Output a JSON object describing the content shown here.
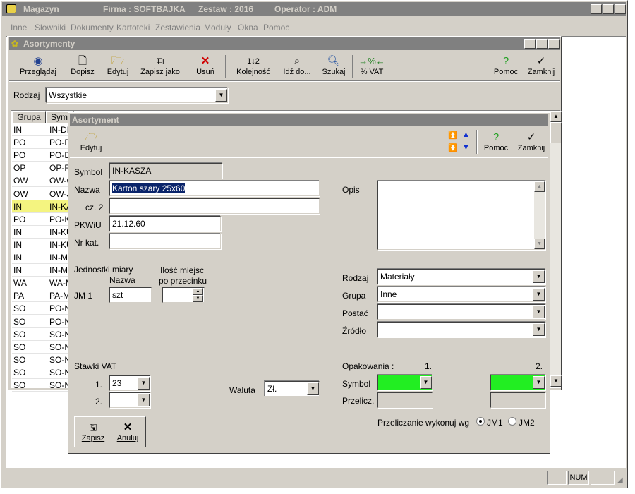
{
  "main_window": {
    "app": "Magazyn",
    "firma": "Firma : SOFTBAJKA",
    "zestaw": "Zestaw : 2016",
    "operator": "Operator : ADM"
  },
  "menu": [
    "Inne",
    "Słowniki",
    "Dokumenty",
    "Kartoteki",
    "Zestawienia",
    "Moduły",
    "Okna",
    "Pomoc"
  ],
  "list_window": {
    "title": "Asortymenty",
    "toolbar": [
      "Przeglądaj",
      "Dopisz",
      "Edytuj",
      "Zapisz jako",
      "Usuń",
      "Kolejność",
      "Idź do...",
      "Szukaj",
      "% VAT",
      "Pomoc",
      "Zamknij"
    ],
    "rodzaj_label": "Rodzaj",
    "rodzaj_value": "Wszystkie",
    "columns": [
      "Grupa",
      "Sym"
    ],
    "rows": [
      {
        "grupa": "IN",
        "sym": "IN-DI"
      },
      {
        "grupa": "PO",
        "sym": "PO-D"
      },
      {
        "grupa": "PO",
        "sym": "PO-D"
      },
      {
        "grupa": "OP",
        "sym": "OP-F"
      },
      {
        "grupa": "OW",
        "sym": "OW-C"
      },
      {
        "grupa": "OW",
        "sym": "OW-J"
      },
      {
        "grupa": "IN",
        "sym": "IN-KA"
      },
      {
        "grupa": "PO",
        "sym": "PO-K"
      },
      {
        "grupa": "IN",
        "sym": "IN-KU"
      },
      {
        "grupa": "IN",
        "sym": "IN-KU"
      },
      {
        "grupa": "IN",
        "sym": "IN-M"
      },
      {
        "grupa": "IN",
        "sym": "IN-MS"
      },
      {
        "grupa": "WA",
        "sym": "WA-M"
      },
      {
        "grupa": "PA",
        "sym": "PA-M"
      },
      {
        "grupa": "SO",
        "sym": "PO-N"
      },
      {
        "grupa": "SO",
        "sym": "PO-N"
      },
      {
        "grupa": "SO",
        "sym": "SO-N"
      },
      {
        "grupa": "SO",
        "sym": "SO-N"
      },
      {
        "grupa": "SO",
        "sym": "SO-N"
      },
      {
        "grupa": "SO",
        "sym": "SO-N"
      },
      {
        "grupa": "SO",
        "sym": "SO-N"
      }
    ]
  },
  "dialog": {
    "title": "Asortyment",
    "edit_label": "Edytuj",
    "pomoc_label": "Pomoc",
    "zamknij_label": "Zamknij",
    "symbol_label": "Symbol",
    "symbol_value": "IN-KASZA",
    "nazwa_label": "Nazwa",
    "nazwa_value": "Karton szary 25x60",
    "cz2_label": "cz. 2",
    "cz2_value": "",
    "pkwiu_label": "PKWiU",
    "pkwiu_value": "21.12.60",
    "nrkat_label": "Nr kat.",
    "nrkat_value": "",
    "opis_label": "Opis",
    "jm_header": "Jednostki miary",
    "jm_nazwa": "Nazwa",
    "ilosc_header1": "Ilość miejsc",
    "ilosc_header2": "po przecinku",
    "jm1_label": "JM 1",
    "jm1_value": "szt",
    "rodzaj_label": "Rodzaj",
    "rodzaj_value": "Materiały",
    "grupa_label": "Grupa",
    "grupa_value": "Inne",
    "postac_label": "Postać",
    "postac_value": "",
    "zrodlo_label": "Źródło",
    "zrodlo_value": "",
    "stawki_label": "Stawki VAT",
    "vat1_label": "1.",
    "vat1_value": "23",
    "vat2_label": "2.",
    "vat2_value": "",
    "waluta_label": "Waluta",
    "waluta_value": "Zł.",
    "opak_label": "Opakowania :",
    "opak_col1": "1.",
    "opak_col2": "2.",
    "opak_symbol": "Symbol",
    "opak_przelicz": "Przelicz.",
    "przeliczanie_label": "Przeliczanie wykonuj wg",
    "radio_jm1": "JM1",
    "radio_jm2": "JM2",
    "zapisz_label": "Zapisz",
    "anuluj_label": "Anuluj"
  },
  "status": {
    "num": "NUM"
  },
  "colors": {
    "title_bar": "#808080",
    "face": "#d4d0c8",
    "selection": "#0a246a",
    "highlight_row": "#f4f480",
    "green_field": "#22ee22"
  }
}
